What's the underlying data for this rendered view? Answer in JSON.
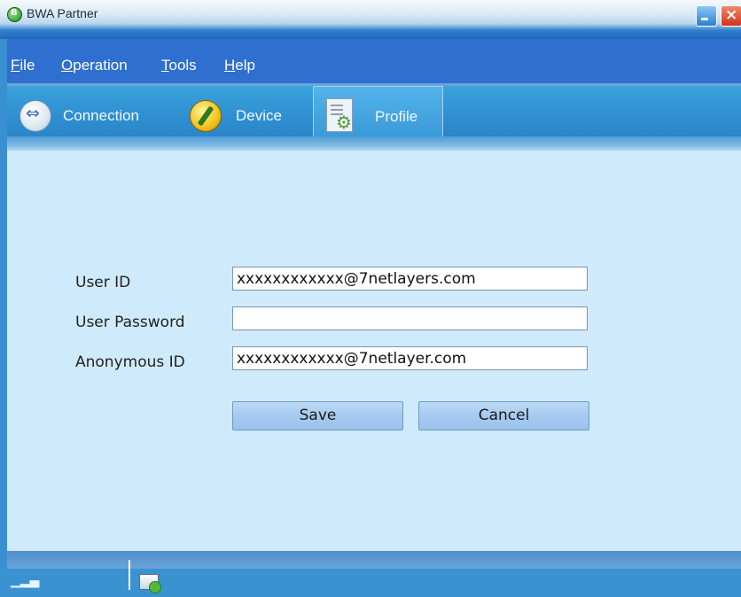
{
  "window": {
    "title": "BWA Partner"
  },
  "menu": {
    "items": [
      {
        "label": "File",
        "accel": "F",
        "rest": "ile"
      },
      {
        "label": "Operation",
        "accel": "O",
        "rest": "peration"
      },
      {
        "label": "Tools",
        "accel": "T",
        "rest": "ools"
      },
      {
        "label": "Help",
        "accel": "H",
        "rest": "elp"
      }
    ]
  },
  "tabs": [
    {
      "label": "Connection",
      "icon": "usb-icon",
      "active": false
    },
    {
      "label": "Device",
      "icon": "wrench-icon",
      "active": false
    },
    {
      "label": "Profile",
      "icon": "profile-settings-icon",
      "active": true
    }
  ],
  "form": {
    "user_id": {
      "label": "User ID",
      "value": "xxxxxxxxxxxx@7netlayers.com"
    },
    "user_password": {
      "label": "User Password",
      "value": ""
    },
    "anonymous_id": {
      "label": "Anonymous ID",
      "value": "xxxxxxxxxxxx@7netlayer.com"
    },
    "save_label": "Save",
    "cancel_label": "Cancel"
  },
  "statusbar": {
    "signal_icon": "signal-strength-icon",
    "network_icon": "network-status-icon"
  },
  "colors": {
    "menubar": "#2e6fd0",
    "tabbar": "#2e8fd0",
    "content_bg": "#cfeafa",
    "button": "#a6caf0"
  }
}
